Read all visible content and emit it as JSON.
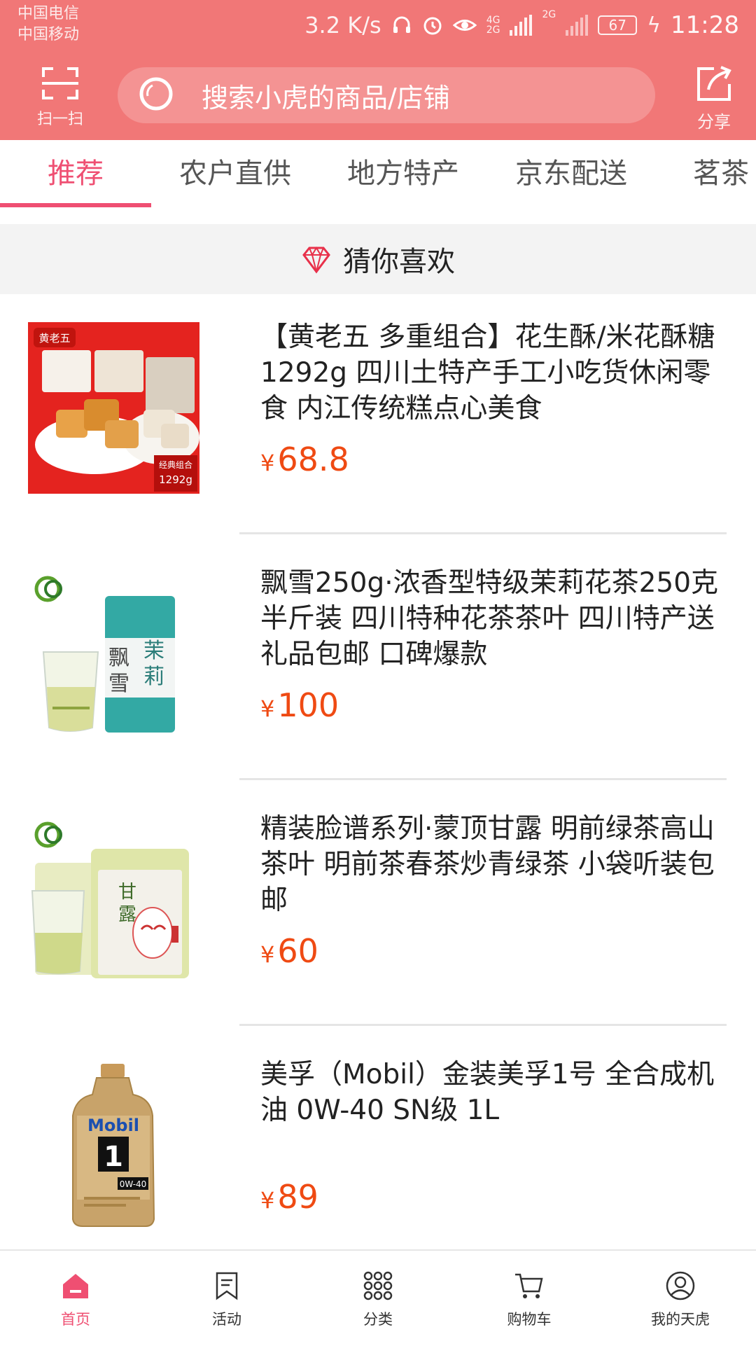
{
  "status_bar": {
    "carrier_1": "中国电信",
    "carrier_2": "中国移动",
    "net_speed": "3.2 K/s",
    "network_4g": "4G",
    "network_2g_a": "2G",
    "network_2g_b": "2G",
    "battery": "67",
    "time": "11:28"
  },
  "header": {
    "scan_label": "扫一扫",
    "search_placeholder": "搜索小虎的商品/店铺",
    "share_label": "分享"
  },
  "tabs": [
    {
      "label": "推荐",
      "active": true
    },
    {
      "label": "农户直供",
      "active": false
    },
    {
      "label": "地方特产",
      "active": false
    },
    {
      "label": "京东配送",
      "active": false
    },
    {
      "label": "茗茶",
      "active": false
    }
  ],
  "section": {
    "title": "猜你喜欢"
  },
  "products": [
    {
      "name": "【黄老五 多重组合】花生酥/米花酥糖1292g 四川土特产手工小吃货休闲零食 内江传统糕点心美食",
      "currency": "¥",
      "price": "68.8",
      "image_text_1": "黄老五",
      "image_text_2": "经典组合",
      "image_text_3": "1292g"
    },
    {
      "name": "飘雪250g·浓香型特级茉莉花茶250克半斤装 四川特种花茶茶叶 四川特产送礼品包邮 口碑爆款",
      "currency": "¥",
      "price": "100",
      "image_text_1": "飘",
      "image_text_2": "雪",
      "image_text_3": "茉",
      "image_text_4": "莉"
    },
    {
      "name": "精装脸谱系列·蒙顶甘露 明前绿茶高山茶叶 明前茶春茶炒青绿茶 小袋听装包邮",
      "currency": "¥",
      "price": "60",
      "image_text_1": "甘",
      "image_text_2": "露"
    },
    {
      "name": "美孚（Mobil）金装美孚1号 全合成机油 0W-40 SN级 1L",
      "currency": "¥",
      "price": "89",
      "image_text_1": "Mobil",
      "image_text_2": "1",
      "image_text_3": "0W-40"
    }
  ],
  "bottom_nav": [
    {
      "label": "首页",
      "icon": "home-icon",
      "active": true
    },
    {
      "label": "活动",
      "icon": "bookmark-icon",
      "active": false
    },
    {
      "label": "分类",
      "icon": "grid-icon",
      "active": false
    },
    {
      "label": "购物车",
      "icon": "cart-icon",
      "active": false
    },
    {
      "label": "我的天虎",
      "icon": "profile-icon",
      "active": false
    }
  ],
  "colors": {
    "header_bg": "#f17777",
    "accent": "#ef4f72",
    "price": "#ef4a13"
  }
}
